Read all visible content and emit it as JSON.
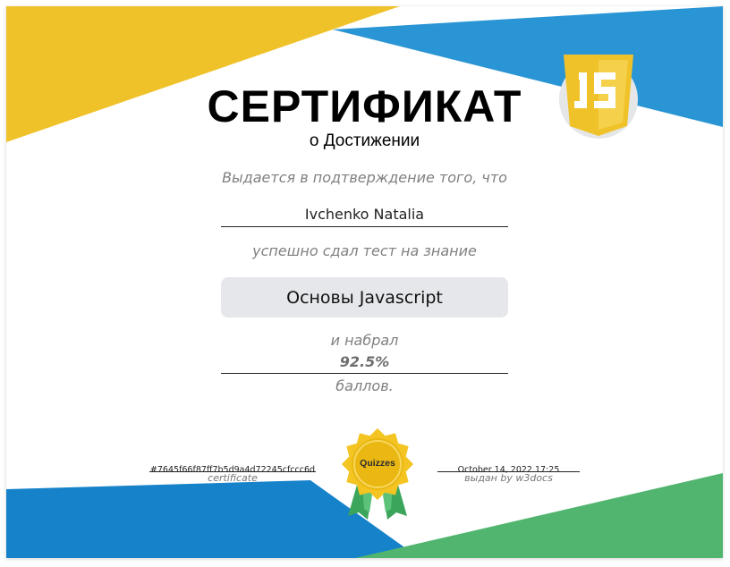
{
  "certificate": {
    "title": "СЕРТИФИКАТ",
    "subtitle": "о Достижении",
    "awarded_text": "Выдается в подтверждение того, что",
    "recipient_name": "Ivchenko Natalia",
    "passed_text": "успешно сдал тест на знание",
    "course_name": "Основы Javascript",
    "scored_text": "и набрал",
    "score": "92.5%",
    "points_text": "баллов.",
    "certificate_id": "#7645f66f87ff7b5d9a4d72245cfccc6d",
    "certificate_label": "certificate",
    "issue_date": "October 14, 2022 17:25",
    "issuer": "выдан by w3docs"
  },
  "logo": {
    "text": "JS",
    "icon": "javascript-shield-icon"
  },
  "badge": {
    "text": "Quizzes",
    "icon": "quizzes-rosette-badge-icon"
  },
  "colors": {
    "yellow": "#f0c22a",
    "blue": "#2a95d4",
    "blue_dark": "#1582c9",
    "green": "#52b56f",
    "course_box": "#e6e7ea"
  }
}
